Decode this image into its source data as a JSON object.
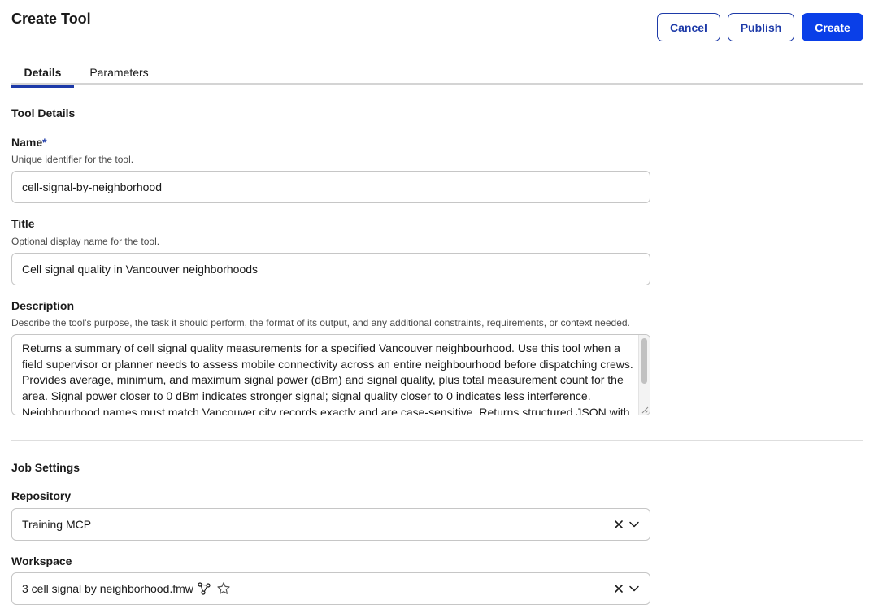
{
  "page": {
    "title": "Create Tool"
  },
  "header": {
    "cancel_label": "Cancel",
    "publish_label": "Publish",
    "create_label": "Create",
    "primary_color": "#0a3fe8"
  },
  "tabs": [
    {
      "label": "Details",
      "active": true
    },
    {
      "label": "Parameters",
      "active": false
    }
  ],
  "tool_details": {
    "section_title": "Tool Details",
    "name": {
      "label": "Name",
      "required_marker": "*",
      "help": "Unique identifier for the tool.",
      "value": "cell-signal-by-neighborhood"
    },
    "title": {
      "label": "Title",
      "help": "Optional display name for the tool.",
      "value": "Cell signal quality in Vancouver neighborhoods"
    },
    "description": {
      "label": "Description",
      "help": "Describe the tool’s purpose, the task it should perform, the format of its output, and any additional constraints, requirements, or context needed.",
      "value": "Returns a summary of cell signal quality measurements for a specified Vancouver neighbourhood. Use this tool when a field supervisor or planner needs to assess mobile connectivity across an entire neighbourhood before dispatching crews. Provides average, minimum, and maximum signal power (dBm) and signal quality, plus total measurement count for the area. Signal power closer to 0 dBm indicates stronger signal; signal quality closer to 0 indicates less interference. Neighbourhood names must match Vancouver city records exactly and are case-sensitive. Returns structured JSON with"
    }
  },
  "job_settings": {
    "section_title": "Job Settings",
    "repository": {
      "label": "Repository",
      "value": "Training MCP",
      "icons": [
        "clear-icon",
        "chevron-down-icon"
      ]
    },
    "workspace": {
      "label": "Workspace",
      "value": "3 cell signal by neighborhood.fmw",
      "icons": [
        "workflow-icon",
        "star-icon",
        "clear-icon",
        "chevron-down-icon"
      ]
    }
  }
}
